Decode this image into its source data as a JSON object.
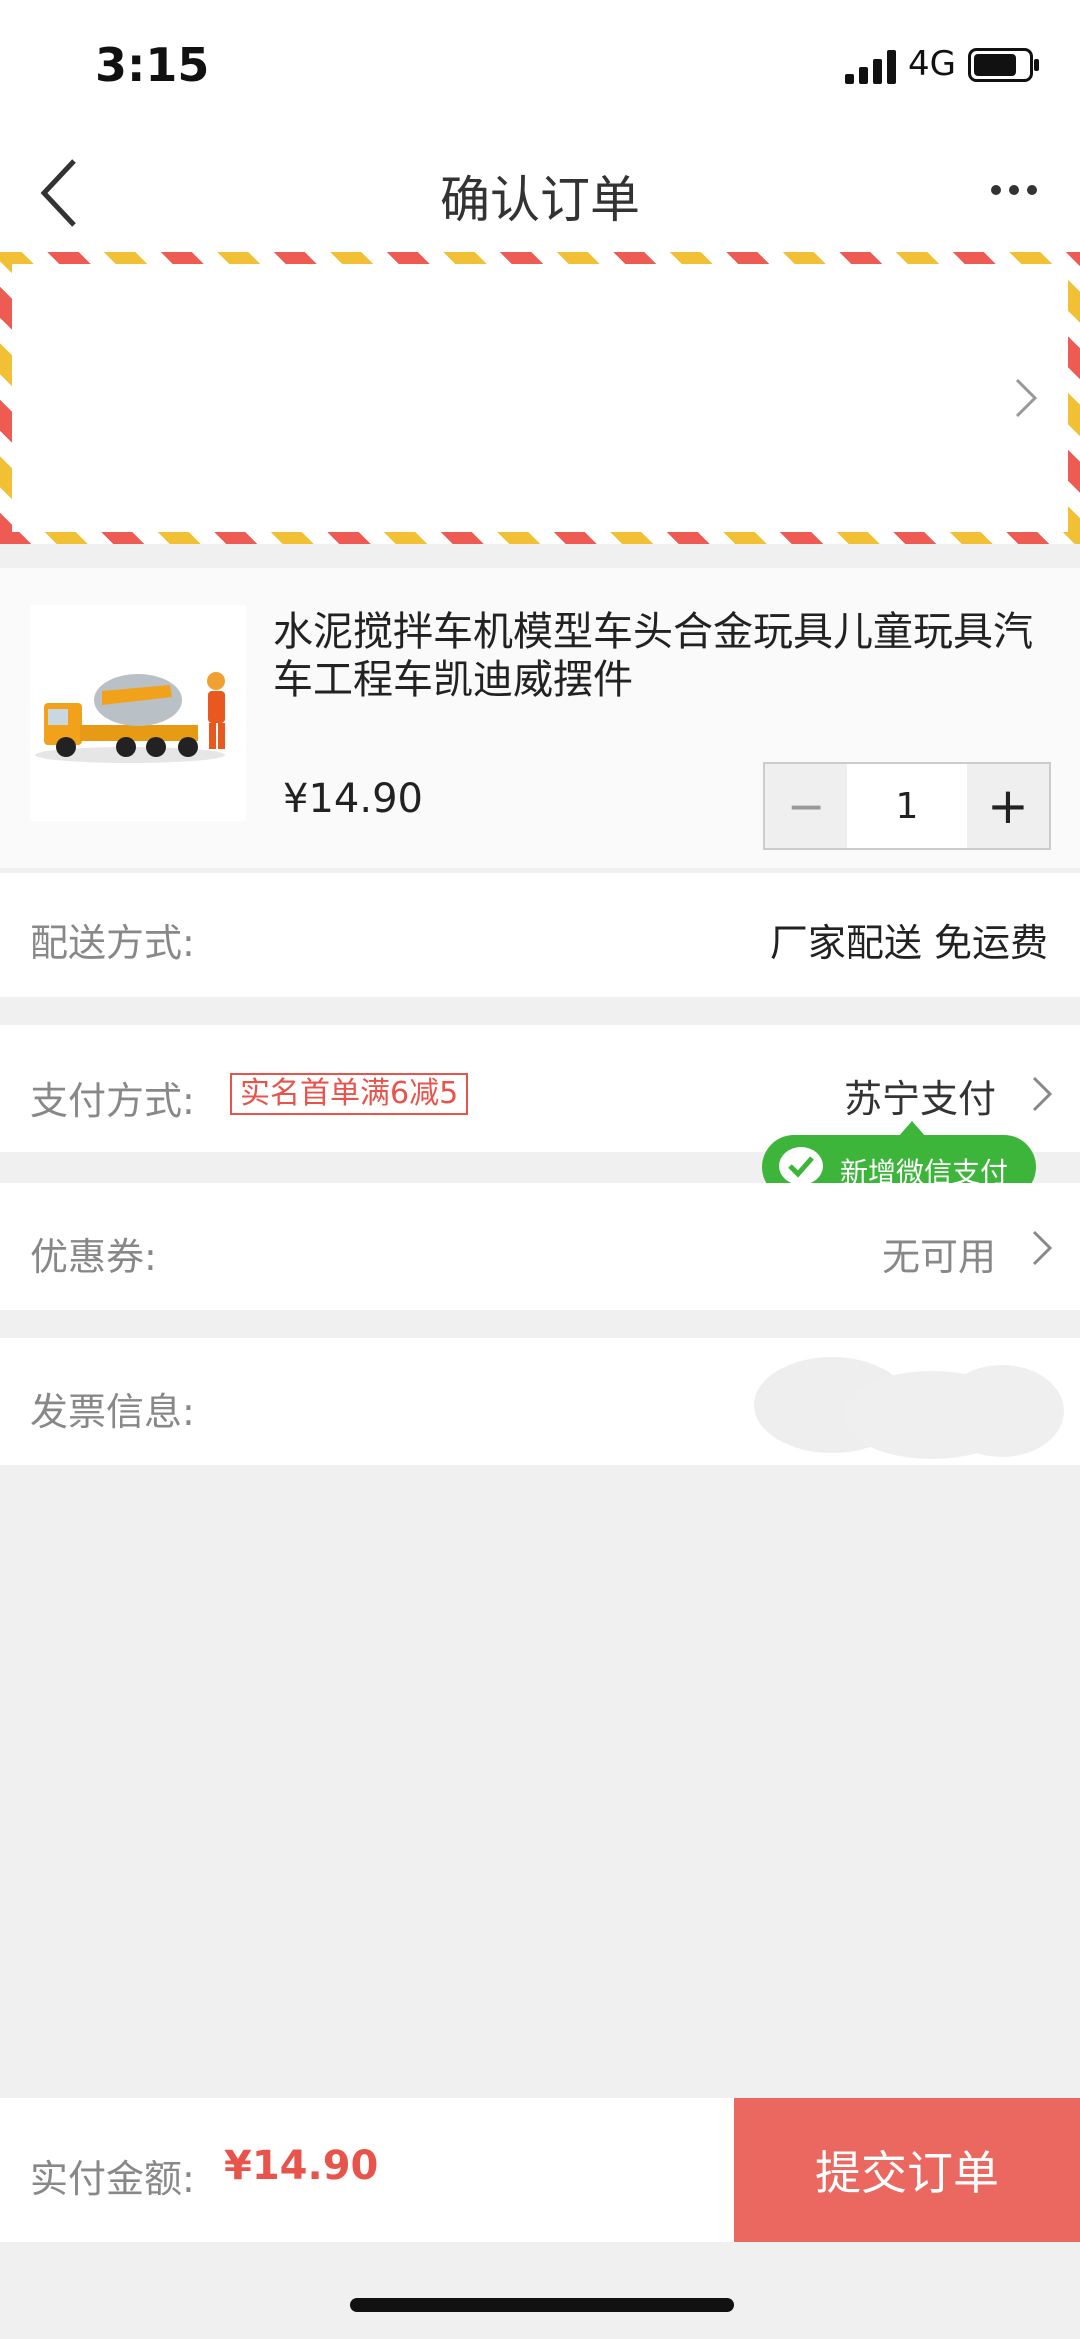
{
  "status_bar": {
    "time": "3:15",
    "network": "4G"
  },
  "nav": {
    "title": "确认订单"
  },
  "product": {
    "title": "水泥搅拌车机模型车头合金玩具儿童玩具汽车工程车凯迪威摆件",
    "price": "¥14.90",
    "quantity": "1",
    "minus_label": "−",
    "plus_label": "+"
  },
  "delivery": {
    "label": "配送方式:",
    "value": "厂家配送 免运费"
  },
  "payment": {
    "label": "支付方式:",
    "promo": "实名首单满6减5",
    "value": "苏宁支付",
    "wechat_tip": "新增微信支付"
  },
  "coupon": {
    "label": "优惠券:",
    "value": "无可用"
  },
  "invoice": {
    "label": "发票信息:"
  },
  "footer": {
    "total_label": "实付金额:",
    "total_amount": "¥14.90",
    "submit_label": "提交订单"
  },
  "colors": {
    "accent": "#ea6860",
    "wechat": "#3db53a"
  }
}
